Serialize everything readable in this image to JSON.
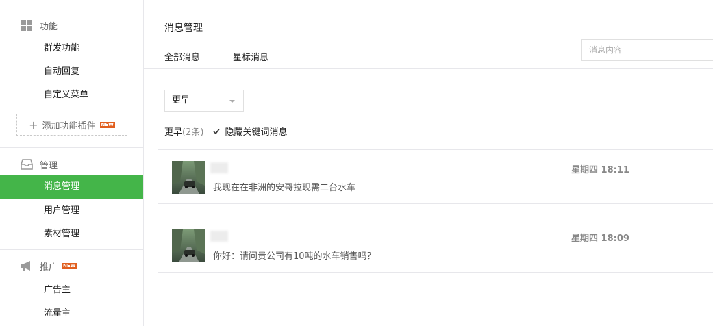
{
  "sidebar": {
    "sections": [
      {
        "title": "功能",
        "icon": "grid-icon",
        "items": [
          "群发功能",
          "自动回复",
          "自定义菜单"
        ],
        "add_plugin": {
          "label": "添加功能插件",
          "badge": "NEW"
        }
      },
      {
        "title": "管理",
        "icon": "inbox-icon",
        "items": [
          "消息管理",
          "用户管理",
          "素材管理"
        ],
        "active": "消息管理"
      },
      {
        "title": "推广",
        "icon": "megaphone-icon",
        "badge": "NEW",
        "items": [
          "广告主",
          "流量主"
        ]
      }
    ]
  },
  "main": {
    "title": "消息管理",
    "tabs": [
      "全部消息",
      "星标消息"
    ],
    "search": {
      "placeholder": "消息内容"
    },
    "filter": {
      "selected": "更早"
    },
    "summary": {
      "group": "更早",
      "count": "(2条)",
      "hide_keyword_label": "隐藏关键词消息",
      "hide_keyword_checked": true
    },
    "messages": [
      {
        "text": "我现在在非洲的安哥拉现需二台水车",
        "time": "星期四 18:11"
      },
      {
        "text": "你好：请问贵公司有10吨的水车销售吗？",
        "time": "星期四 18:09"
      }
    ]
  },
  "colors": {
    "accent": "#44b549",
    "badge": "#e15f1f",
    "border": "#e7e7eb"
  }
}
